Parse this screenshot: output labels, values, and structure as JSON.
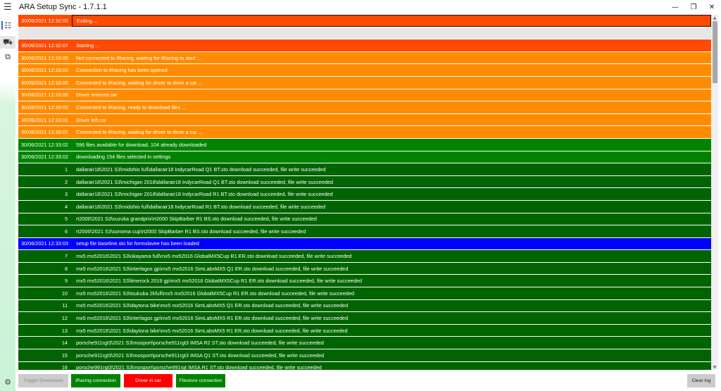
{
  "window": {
    "title": "ARA Setup Sync - 1.7.1.1",
    "menu_icon": "☰",
    "minimize_icon": "—",
    "maximize_icon": "❐",
    "close_icon": "✕"
  },
  "nav": {
    "icons": [
      {
        "name": "log-list-icon",
        "glyph": "☷"
      },
      {
        "name": "car-icon",
        "glyph": "⛟"
      },
      {
        "name": "copy-files-icon",
        "glyph": "⧉"
      }
    ],
    "settings_icon": "⚙"
  },
  "log": {
    "rows": [
      {
        "style": "red",
        "boxed": true,
        "time": "30/06/2021 12:32:00",
        "message": "Exiting ..."
      },
      {
        "style": "grey",
        "time": "",
        "message": ""
      },
      {
        "style": "red",
        "time": "30/06/2021 12:32:07",
        "message": "Starting ..."
      },
      {
        "style": "orange",
        "time": "30/06/2021 12:33:00",
        "message": "Not connected to iRacing, waiting for iRacing to start ..."
      },
      {
        "style": "orange",
        "time": "30/06/2021 12:33:00",
        "message": "Connection to iRacing has been opened"
      },
      {
        "style": "orange",
        "time": "30/06/2021 12:33:00",
        "message": "Connected to iRacing, waiting for driver to drive a car ..."
      },
      {
        "style": "orange",
        "time": "30/06/2021 12:33:00",
        "message": "Driver entered car"
      },
      {
        "style": "orange",
        "time": "30/06/2021 12:33:00",
        "message": "Connected to iRacing, ready to download files ..."
      },
      {
        "style": "orange",
        "time": "30/06/2021 12:33:01",
        "message": "Driver left car"
      },
      {
        "style": "orange",
        "time": "30/06/2021 12:33:01",
        "message": "Connected to iRacing, waiting for driver to drive a car ..."
      },
      {
        "style": "lime",
        "time": "30/06/2021 12:33:02",
        "message": "596 files available for download, 104 already downloaded"
      },
      {
        "style": "lime",
        "time": "30/06/2021 12:33:02",
        "message": "downloading 154 files selected in settings"
      },
      {
        "style": "dkgreen",
        "num": "1",
        "message": "dallarair18\\2021 S3\\midohio full\\dallarair18 IndycarRoad Q1 BT.sto download succeeded, file write succeeded"
      },
      {
        "style": "dkgreen",
        "num": "2",
        "message": "dallarair18\\2021 S3\\michigan 2018\\dallarair18 IndycarRoad Q1 BT.sto download succeeded, file write succeeded"
      },
      {
        "style": "dkgreen",
        "num": "3",
        "message": "dallarair18\\2021 S3\\michigan 2018\\dallarair18 IndycarRoad R1 BT.sto download succeeded, file write succeeded"
      },
      {
        "style": "dkgreen",
        "num": "4",
        "message": "dallarair18\\2021 S3\\midohio full\\dallarair18 IndycarRoad R1 BT.sto download succeeded, file write succeeded"
      },
      {
        "style": "dkgreen",
        "num": "5",
        "message": "rt2000\\2021 S3\\suzuka grandprix\\rt2000 SkipBarber R1 BS.sto download succeeded, file write succeeded"
      },
      {
        "style": "dkgreen",
        "num": "6",
        "message": "rt2000\\2021 S3\\sonoma cup\\rt2000 SkipBarber R1 BS.sto download succeeded, file write succeeded"
      },
      {
        "style": "blue",
        "time": "30/06/2021 12:33:03",
        "message": "setup file baseline.sto for formulavee has been loaded"
      },
      {
        "style": "dkgreen",
        "num": "7",
        "message": "mx5 mx52016\\2021 S3\\okayama full\\mx5 mx52016 GlobalMX5Cup R1 ER.sto download succeeded, file write succeeded"
      },
      {
        "style": "dkgreen",
        "num": "8",
        "message": "mx5 mx52016\\2021 S3\\interlagos gp\\mx5 mx52016 SimLabsMX5 Q1 ER.sto download succeeded, file write succeeded"
      },
      {
        "style": "dkgreen",
        "num": "9",
        "message": "mx5 mx52016\\2021 S3\\limerock 2019 gp\\mx5 mx52016 GlobalMX5Cup R1 ER.sto download succeeded, file write succeeded"
      },
      {
        "style": "dkgreen",
        "num": "10",
        "message": "mx5 mx52016\\2021 S3\\tsukuba 2kfull\\mx5 mx52016 GlobalMX5Cup R1 ER.sto download succeeded, file write succeeded"
      },
      {
        "style": "dkgreen",
        "num": "11",
        "message": "mx5 mx52016\\2021 S3\\daytona bike\\mx5 mx52016 SimLabsMX5 Q1 ER.sto download succeeded, file write succeeded"
      },
      {
        "style": "dkgreen",
        "num": "12",
        "message": "mx5 mx52016\\2021 S3\\interlagos gp\\mx5 mx52016 SimLabsMX5 R1 ER.sto download succeeded, file write succeeded"
      },
      {
        "style": "dkgreen",
        "num": "13",
        "message": "mx5 mx52016\\2021 S3\\daytona bike\\mx5 mx52016 SimLabsMX5 R1 ER.sto download succeeded, file write succeeded"
      },
      {
        "style": "dkgreen",
        "num": "14",
        "message": "porsche911rgt3\\2021 S3\\mosport\\porsche911rgt3 IMSA R2 ST.sto download succeeded, file write succeeded"
      },
      {
        "style": "dkgreen",
        "num": "15",
        "message": "porsche911rgt3\\2021 S3\\mosport\\porsche911rgt3 IMSA Q1 ST.sto download succeeded, file write succeeded"
      },
      {
        "style": "dkgreen",
        "num": "16",
        "message": "porsche991rgt3\\2021 S3\\mosport\\porsche991rgt IMSA R1 ST.sto download succeeded, file write succeeded"
      }
    ]
  },
  "bottombar": {
    "trigger_downloads": "Trigger Downloads",
    "iracing_connection": "iRacing connection",
    "driver_in_car": "Driver in car",
    "filestore_connection": "Filestore connection",
    "clear_log": "Clear log"
  },
  "colors": {
    "red": "#ff4a00",
    "orange": "#ff8c00",
    "green": "#008300",
    "dark_green": "#006400",
    "blue": "#0000ff",
    "status_red": "#ff0000"
  }
}
